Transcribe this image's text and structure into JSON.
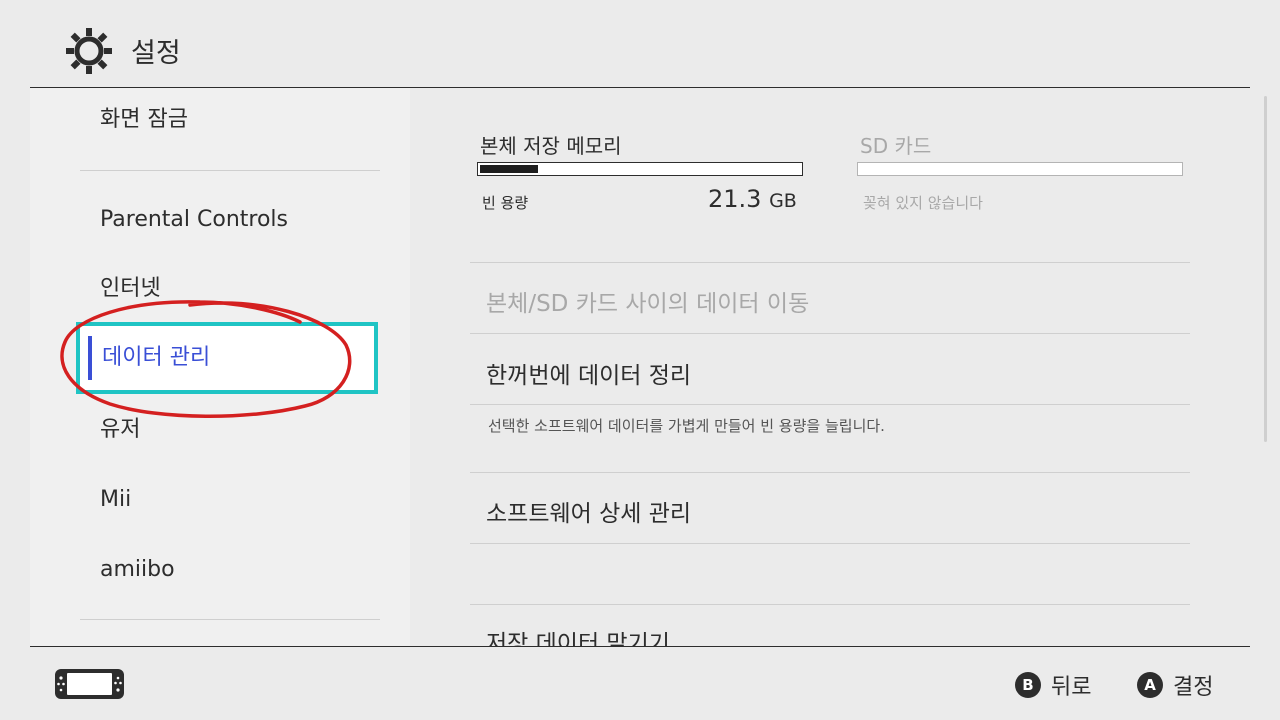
{
  "header": {
    "title": "설정",
    "icon": "gear-icon"
  },
  "sidebar": {
    "items": [
      {
        "label": "화면 잠금"
      },
      {
        "label": "Parental Controls"
      },
      {
        "label": "인터넷"
      },
      {
        "label": "데이터 관리",
        "selected": true
      },
      {
        "label": "유저"
      },
      {
        "label": "Mii"
      },
      {
        "label": "amiibo"
      }
    ]
  },
  "storage": {
    "system": {
      "title": "본체 저장 메모리",
      "free_label": "빈 용량",
      "free_value": "21.3",
      "free_unit": "GB",
      "used_fraction": 0.18
    },
    "sd": {
      "title": "SD 카드",
      "status": "꽂혀 있지 않습니다"
    }
  },
  "menu": {
    "move_data": "본체/SD 카드 사이의 데이터 이동",
    "cleanup": "한꺼번에 데이터 정리",
    "cleanup_desc": "선택한 소프트웨어 데이터를 가볍게 만들어 빈 용량을 늘립니다.",
    "software": "소프트웨어 상세 관리",
    "save_data": "저장 데이터 맡기기"
  },
  "footer": {
    "back_button": "B",
    "back_label": "뒤로",
    "ok_button": "A",
    "ok_label": "결정"
  },
  "colors": {
    "accent": "#3a4fd6",
    "focus": "#1fc4c4",
    "annotation": "#d42020"
  }
}
